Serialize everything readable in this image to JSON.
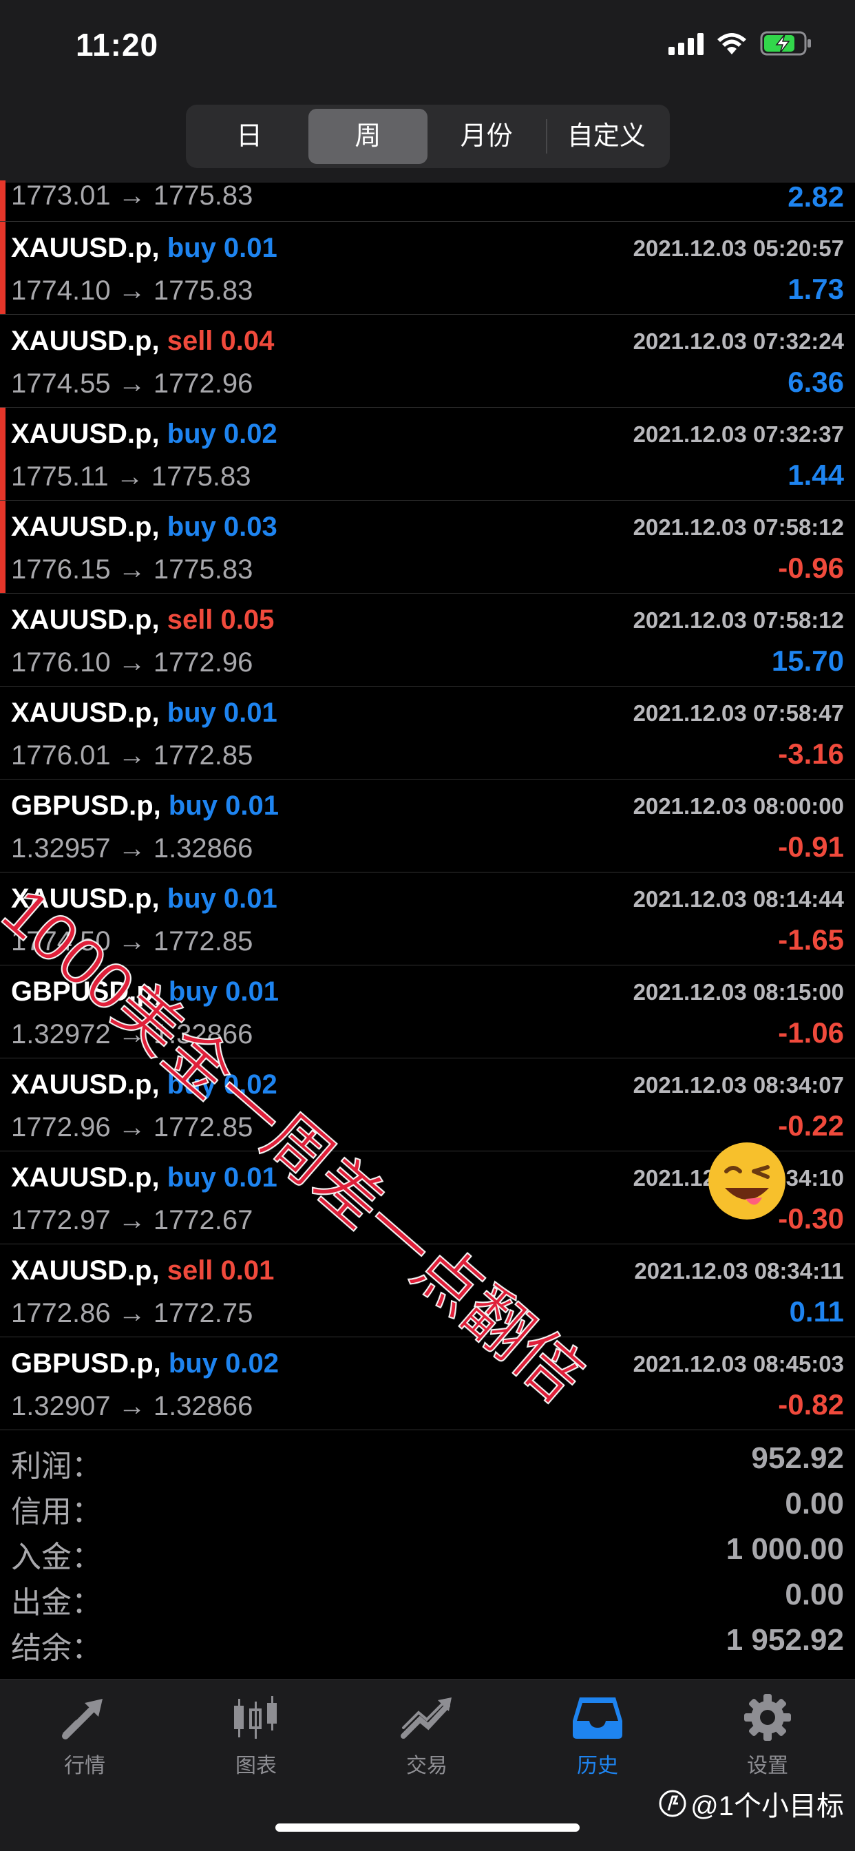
{
  "status": {
    "time": "11:20"
  },
  "header": {
    "tabs": [
      "日",
      "周",
      "月份",
      "自定义"
    ],
    "active_tab": "周"
  },
  "colors": {
    "buy": "#1e84f0",
    "sell": "#f04a3c",
    "marker": "#e5362a"
  },
  "first_row": {
    "prices": "1773.01 → 1775.83",
    "profit": "2.82"
  },
  "deals": [
    {
      "symbol": "XAUUSD.p,",
      "side": "buy 0.01",
      "time": "2021.12.03 05:20:57",
      "prices": "1774.10 → 1775.83",
      "profit": "1.73"
    },
    {
      "symbol": "XAUUSD.p,",
      "side": "sell 0.04",
      "time": "2021.12.03 07:32:24",
      "prices": "1774.55 → 1772.96",
      "profit": "6.36"
    },
    {
      "symbol": "XAUUSD.p,",
      "side": "buy 0.02",
      "time": "2021.12.03 07:32:37",
      "prices": "1775.11 → 1775.83",
      "profit": "1.44"
    },
    {
      "symbol": "XAUUSD.p,",
      "side": "buy 0.03",
      "time": "2021.12.03 07:58:12",
      "prices": "1776.15 → 1775.83",
      "profit": "-0.96"
    },
    {
      "symbol": "XAUUSD.p,",
      "side": "sell 0.05",
      "time": "2021.12.03 07:58:12",
      "prices": "1776.10 → 1772.96",
      "profit": "15.70"
    },
    {
      "symbol": "XAUUSD.p,",
      "side": "buy 0.01",
      "time": "2021.12.03 07:58:47",
      "prices": "1776.01 → 1772.85",
      "profit": "-3.16"
    },
    {
      "symbol": "GBPUSD.p,",
      "side": "buy 0.01",
      "time": "2021.12.03 08:00:00",
      "prices": "1.32957 → 1.32866",
      "profit": "-0.91"
    },
    {
      "symbol": "XAUUSD.p,",
      "side": "buy 0.01",
      "time": "2021.12.03 08:14:44",
      "prices": "1774.50 → 1772.85",
      "profit": "-1.65"
    },
    {
      "symbol": "GBPUSD.p,",
      "side": "buy 0.01",
      "time": "2021.12.03 08:15:00",
      "prices": "1.32972 → 1.32866",
      "profit": "-1.06"
    },
    {
      "symbol": "XAUUSD.p,",
      "side": "buy 0.02",
      "time": "2021.12.03 08:34:07",
      "prices": "1772.96 → 1772.85",
      "profit": "-0.22"
    },
    {
      "symbol": "XAUUSD.p,",
      "side": "buy 0.01",
      "time": "2021.12.03 08:34:10",
      "prices": "1772.97 → 1772.67",
      "profit": "-0.30"
    },
    {
      "symbol": "XAUUSD.p,",
      "side": "sell 0.01",
      "time": "2021.12.03 08:34:11",
      "prices": "1772.86 → 1772.75",
      "profit": "0.11"
    },
    {
      "symbol": "GBPUSD.p,",
      "side": "buy 0.02",
      "time": "2021.12.03 08:45:03",
      "prices": "1.32907 → 1.32866",
      "profit": "-0.82"
    }
  ],
  "summary": [
    {
      "label": "利润：",
      "value": "952.92"
    },
    {
      "label": "信用：",
      "value": "0.00"
    },
    {
      "label": "入金：",
      "value": "1 000.00"
    },
    {
      "label": "出金：",
      "value": "0.00"
    },
    {
      "label": "结余：",
      "value": "1 952.92"
    }
  ],
  "tabbar": [
    {
      "label": "行情",
      "icon": "quotes-arrows-icon"
    },
    {
      "label": "图表",
      "icon": "candlestick-chart-icon"
    },
    {
      "label": "交易",
      "icon": "trade-trend-icon"
    },
    {
      "label": "历史",
      "icon": "history-inbox-icon",
      "active": true
    },
    {
      "label": "设置",
      "icon": "settings-gear-icon"
    }
  ],
  "overlay": {
    "watermark_text": "1000美金一周差一点翻倍",
    "brand": "@1个小目标"
  }
}
